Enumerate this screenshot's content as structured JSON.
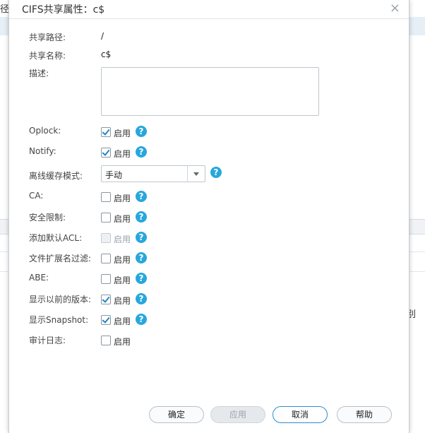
{
  "background": {
    "left_label": "径",
    "right_label": "别"
  },
  "dialog": {
    "title": "CIFS共享属性：c$",
    "close_glyph": "×",
    "fields": {
      "share_path": {
        "label": "共享路径:",
        "value": "/"
      },
      "share_name": {
        "label": "共享名称:",
        "value": "c$"
      },
      "description": {
        "label": "描述:",
        "value": ""
      },
      "oplock": {
        "label": "Oplock:",
        "check_label": "启用",
        "checked": true,
        "disabled": false
      },
      "notify": {
        "label": "Notify:",
        "check_label": "启用",
        "checked": true,
        "disabled": false
      },
      "offline_cache": {
        "label": "离线缓存模式:",
        "selected": "手动"
      },
      "ca": {
        "label": "CA:",
        "check_label": "启用",
        "checked": false,
        "disabled": false
      },
      "security_limit": {
        "label": "安全限制:",
        "check_label": "启用",
        "checked": false,
        "disabled": false
      },
      "default_acl": {
        "label": "添加默认ACL:",
        "check_label": "启用",
        "checked": false,
        "disabled": true
      },
      "file_ext_filter": {
        "label": "文件扩展名过滤:",
        "check_label": "启用",
        "checked": false,
        "disabled": false
      },
      "abe": {
        "label": "ABE:",
        "check_label": "启用",
        "checked": false,
        "disabled": false
      },
      "previous_versions": {
        "label": "显示以前的版本:",
        "check_label": "启用",
        "checked": true,
        "disabled": false
      },
      "show_snapshot": {
        "label": "显示Snapshot:",
        "check_label": "启用",
        "checked": true,
        "disabled": false
      },
      "audit_log": {
        "label": "审计日志:",
        "check_label": "启用",
        "checked": false,
        "disabled": false
      }
    },
    "help_glyph": "?",
    "buttons": {
      "ok": "确定",
      "apply": "应用",
      "cancel": "取消",
      "help": "帮助"
    }
  },
  "colors": {
    "accent": "#27a7dc",
    "check": "#1f86c8",
    "primary_border": "#2b8ed0"
  }
}
